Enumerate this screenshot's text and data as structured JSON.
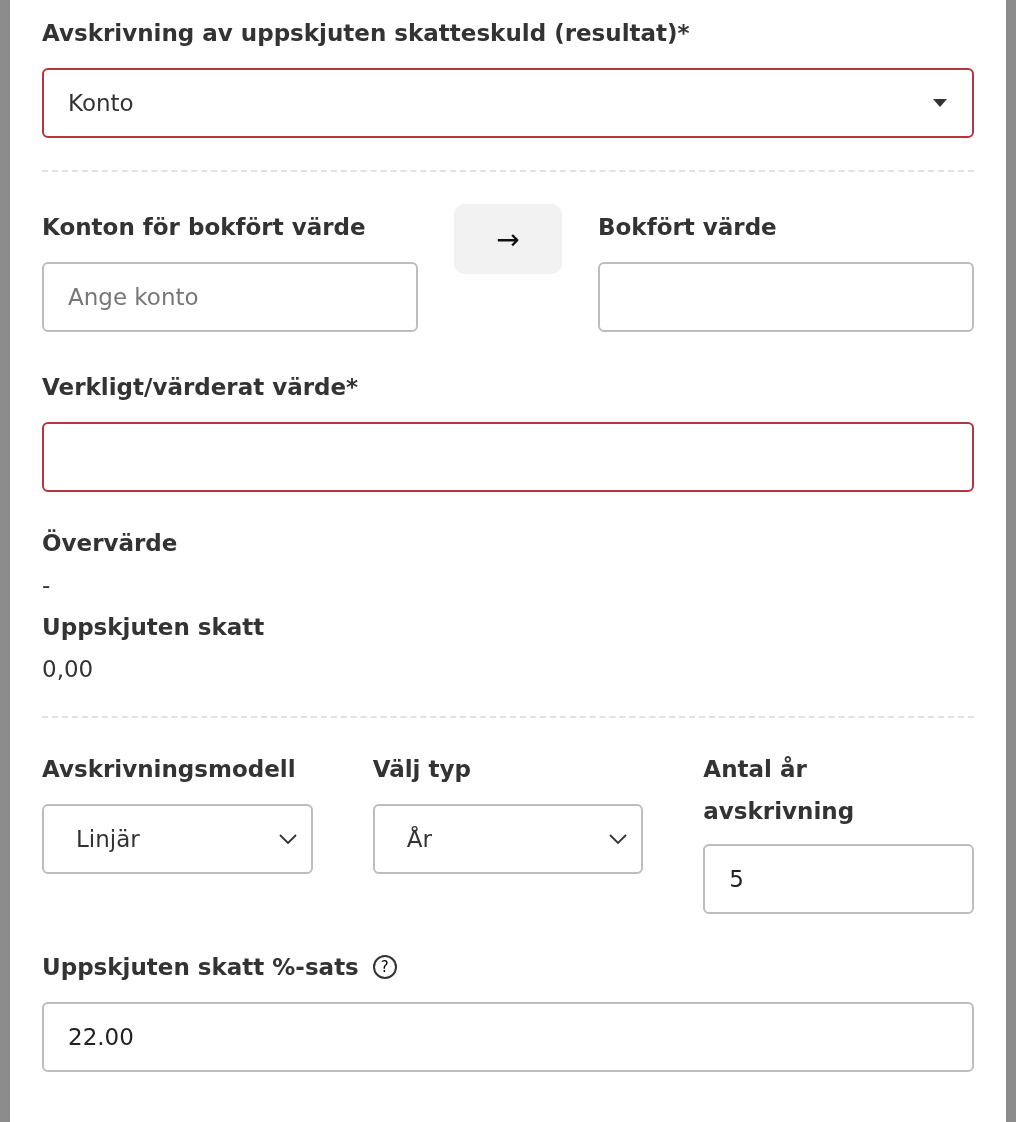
{
  "depreciation_account": {
    "label": "Avskrivning av uppskjuten skatteskuld (resultat)*",
    "value": "Konto",
    "error": true
  },
  "book_accounts": {
    "label": "Konton för bokfört värde",
    "placeholder": "Ange konto",
    "error": false
  },
  "transfer_button": {
    "glyph": "→"
  },
  "book_value": {
    "label": "Bokfört värde",
    "error": false
  },
  "fair_value": {
    "label": "Verkligt/värderat värde*",
    "error": true
  },
  "surplus": {
    "label": "Övervärde",
    "value": "-"
  },
  "deferred_tax": {
    "label": "Uppskjuten skatt",
    "value": "0,00"
  },
  "model": {
    "label": "Avskrivningsmodell",
    "value": "Linjär"
  },
  "type": {
    "label": "Välj typ",
    "value": "År"
  },
  "years": {
    "label": "Antal år avskrivning",
    "value": "5",
    "error": false
  },
  "tax_rate": {
    "label": "Uppskjuten skatt %-sats",
    "value": "22.00",
    "error": false,
    "help": "?"
  }
}
